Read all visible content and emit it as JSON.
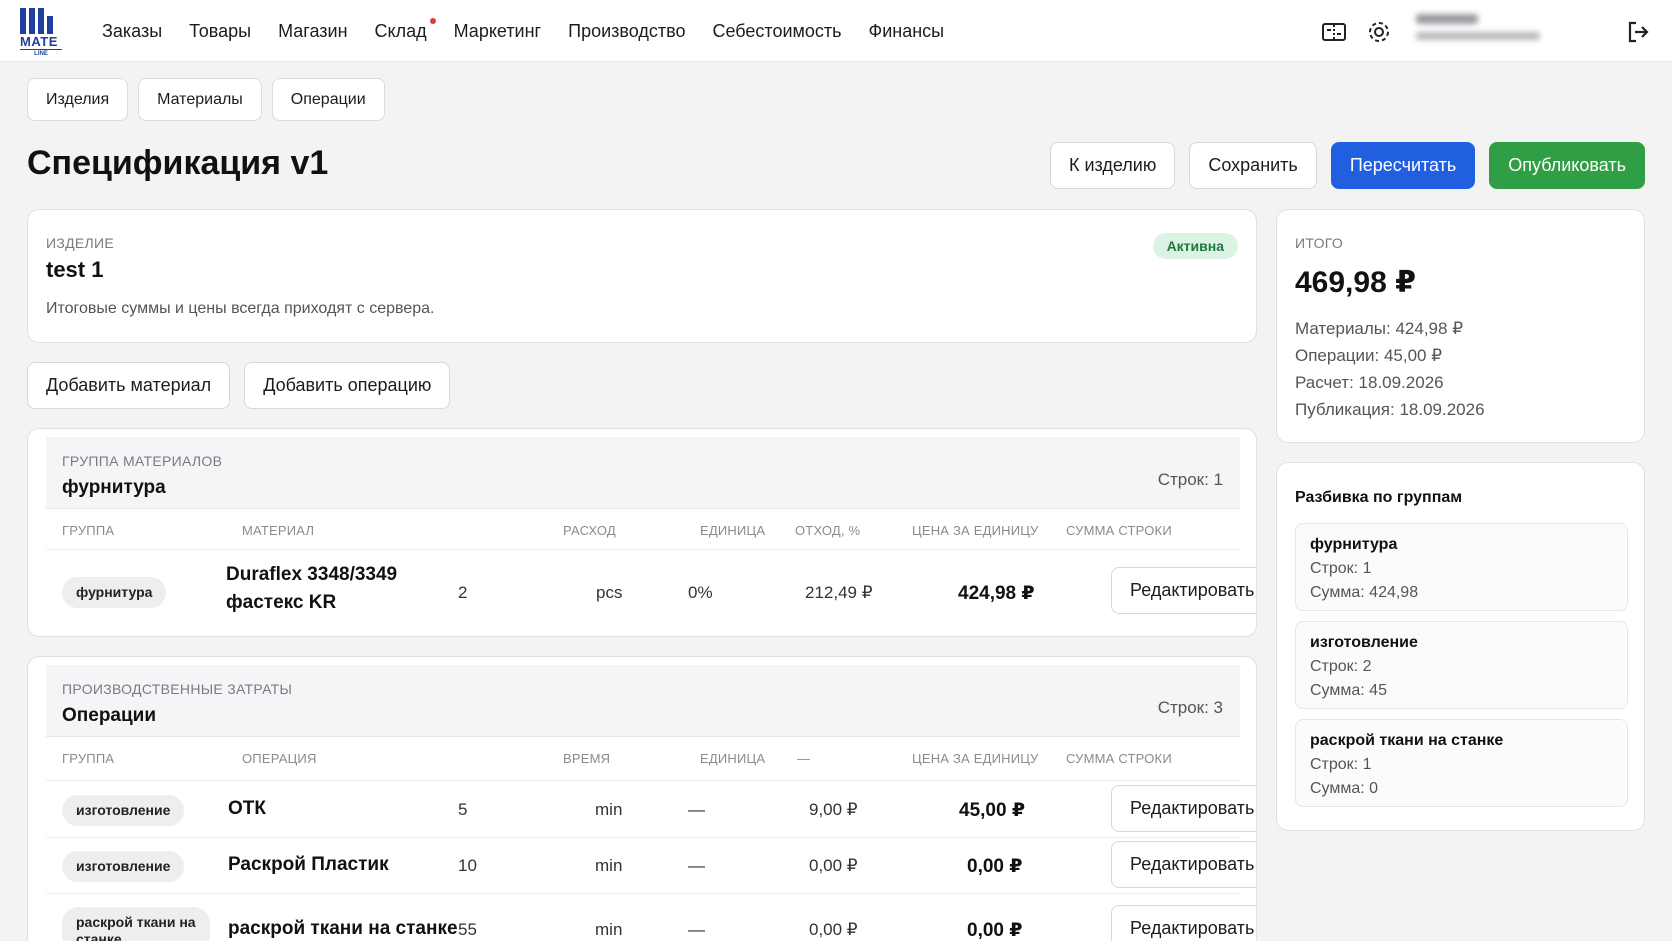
{
  "header": {
    "logo_text": "MATE",
    "logo_sub": "LINE",
    "nav": [
      "Заказы",
      "Товары",
      "Магазин",
      "Склад",
      "Маркетинг",
      "Производство",
      "Себестоимость",
      "Финансы"
    ],
    "icons": [
      "ticket-icon",
      "gear-icon",
      "logout-icon"
    ]
  },
  "subtabs": [
    "Изделия",
    "Материалы",
    "Операции"
  ],
  "page": {
    "title": "Спецификация v1",
    "actions": {
      "back": "К изделию",
      "save": "Сохранить",
      "recalc": "Пересчитать",
      "publish": "Опубликовать"
    }
  },
  "product": {
    "label": "Изделие",
    "name": "test 1",
    "note": "Итоговые суммы и цены всегда приходят с сервера.",
    "status": "Активна"
  },
  "add_buttons": {
    "material": "Добавить материал",
    "operation": "Добавить операцию"
  },
  "materials_group": {
    "label": "Группа материалов",
    "name": "фурнитура",
    "rows_count": "Строк: 1",
    "columns": [
      "Группа",
      "Материал",
      "Расход",
      "Единица",
      "Отход, %",
      "Цена за единицу",
      "Сумма строки"
    ],
    "rows": [
      {
        "group": "фурнитура",
        "material_line1": "Duraflex 3348/3349",
        "material_line2": "фастекс KR",
        "qty": "2",
        "unit": "pcs",
        "waste": "0%",
        "price": "212,49 ₽",
        "sum": "424,98 ₽",
        "edit": "Редактировать"
      }
    ]
  },
  "operations_group": {
    "label": "Производственные затраты",
    "name": "Операции",
    "rows_count": "Строк: 3",
    "columns": [
      "Группа",
      "Операция",
      "Время",
      "Единица",
      "—",
      "Цена за единицу",
      "Сумма строки"
    ],
    "rows": [
      {
        "group": "изготовление",
        "op": "ОТК",
        "time": "5",
        "unit": "min",
        "dash": "—",
        "price": "9,00 ₽",
        "sum": "45,00 ₽",
        "edit": "Редактировать"
      },
      {
        "group": "изготовление",
        "op": "Раскрой Пластик",
        "time": "10",
        "unit": "min",
        "dash": "—",
        "price": "0,00 ₽",
        "sum": "0,00 ₽",
        "edit": "Редактировать"
      },
      {
        "group": "раскрой ткани на станке",
        "op": "раскрой ткани на станке",
        "time": "55",
        "unit": "min",
        "dash": "—",
        "price": "0,00 ₽",
        "sum": "0,00 ₽",
        "edit": "Редактировать"
      }
    ]
  },
  "totals": {
    "label": "Итого",
    "amount": "469,98 ₽",
    "materials": "Материалы: 424,98 ₽",
    "operations": "Операции: 45,00 ₽",
    "calc": "Расчет: 18.09.2026",
    "published": "Публикация: 18.09.2026"
  },
  "breakdown": {
    "title": "Разбивка по группам",
    "items": [
      {
        "name": "фурнитура",
        "rows": "Строк: 1",
        "sum": "Сумма: 424,98"
      },
      {
        "name": "изготовление",
        "rows": "Строк: 2",
        "sum": "Сумма: 45"
      },
      {
        "name": "раскрой ткани на станке",
        "rows": "Строк: 1",
        "sum": "Сумма: 0"
      }
    ]
  },
  "colors": {
    "primary": "#1f5fe0",
    "success": "#2f9e44",
    "logo": "#1f3f9e",
    "badge_bg": "#dcf3e4",
    "badge_text": "#1e7a3c",
    "notify_dot": "#e53935"
  }
}
